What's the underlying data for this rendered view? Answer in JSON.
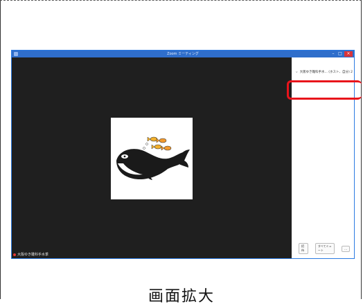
{
  "window": {
    "title": "Zoom ミーティング",
    "controls": [
      "–",
      "□",
      "×"
    ]
  },
  "video": {
    "self_name": "大阪ゆき雛科手水季"
  },
  "side_panel": {
    "participant_label": "大阪ゆき雛科手水... (ホスト、自分) 2",
    "footer": {
      "invite_label": "招待",
      "mute_all_label": "すべてミュート",
      "more_label": "..."
    }
  },
  "caption": {
    "text": "画面拡大"
  },
  "colors": {
    "accent": "#2f6ecb",
    "highlight": "#e8141b",
    "video_bg": "#1f1f1f"
  }
}
